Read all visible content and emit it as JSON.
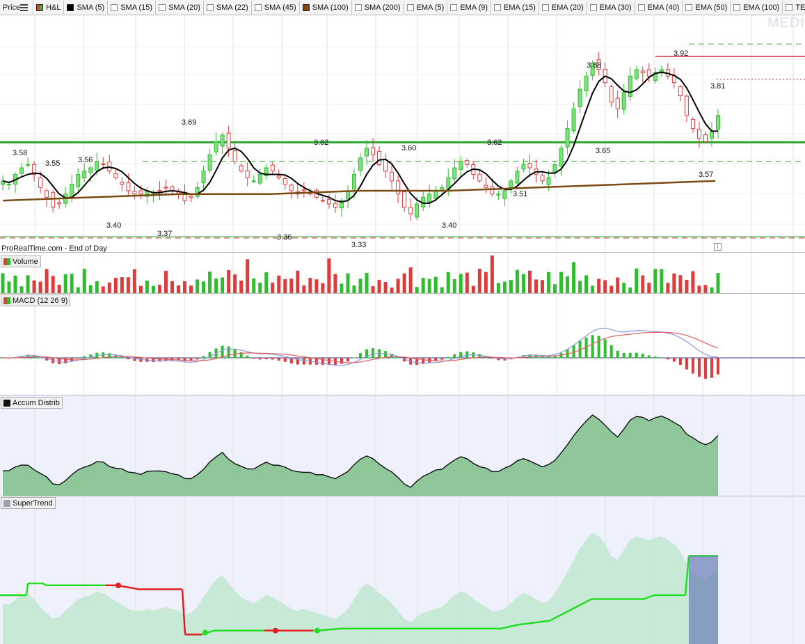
{
  "toolbar": {
    "items": [
      {
        "label": "Price",
        "swatch": "none"
      },
      {
        "label": "H&L",
        "swatch": "hl"
      },
      {
        "label": "SMA (5)",
        "swatch": "#000000"
      },
      {
        "label": "SMA (15)",
        "swatch": "empty"
      },
      {
        "label": "SMA (20)",
        "swatch": "empty"
      },
      {
        "label": "SMA (22)",
        "swatch": "empty"
      },
      {
        "label": "SMA (45)",
        "swatch": "empty"
      },
      {
        "label": "SMA (100)",
        "swatch": "#7b4a12"
      },
      {
        "label": "SMA (200)",
        "swatch": "empty"
      },
      {
        "label": "EMA (5)",
        "swatch": "empty"
      },
      {
        "label": "EMA (9)",
        "swatch": "empty"
      },
      {
        "label": "EMA (15)",
        "swatch": "empty"
      },
      {
        "label": "EMA (20)",
        "swatch": "empty"
      },
      {
        "label": "EMA (30)",
        "swatch": "empty"
      },
      {
        "label": "EMA (40)",
        "swatch": "empty"
      },
      {
        "label": "EMA (50)",
        "swatch": "empty"
      },
      {
        "label": "EMA (100)",
        "swatch": "empty"
      },
      {
        "label": "TEST ATR S",
        "swatch": "empty"
      }
    ]
  },
  "watermark": "MEDI",
  "footer": "ProRealTime.com - End of Day",
  "panels": {
    "volume": {
      "label": "Volume"
    },
    "macd": {
      "label": "MACD (12 26 9)"
    },
    "accum": {
      "label": "Accum Distrib"
    },
    "supertrend": {
      "label": "SuperTrend"
    }
  },
  "price_labels": [
    "3.58",
    "3.55",
    "3.56",
    "3.40",
    "3.37",
    "3.69",
    "3.36",
    "3.62",
    "3.33",
    "3.60",
    "3.40",
    "3.62",
    "3.51",
    "3.88",
    "3.65",
    "3.92",
    "3.81",
    "3.57"
  ],
  "colors": {
    "up": "#2fbd2f",
    "down": "#e03b3b",
    "sma5": "#000000",
    "sma100": "#7b4a12",
    "support": "#2aa52a",
    "resist": "#d03030",
    "macd": "#8899dd",
    "signal": "#e06060",
    "accum": "#8fc79b",
    "st_up": "#22dd22",
    "st_down": "#e02020"
  },
  "chart_data": {
    "type": "candlestick",
    "price_range": [
      3.3,
      3.98
    ],
    "closes": [
      3.5,
      3.49,
      3.52,
      3.54,
      3.55,
      3.52,
      3.48,
      3.45,
      3.42,
      3.43,
      3.46,
      3.49,
      3.52,
      3.53,
      3.54,
      3.56,
      3.55,
      3.53,
      3.51,
      3.49,
      3.47,
      3.46,
      3.46,
      3.47,
      3.46,
      3.47,
      3.48,
      3.47,
      3.46,
      3.44,
      3.45,
      3.48,
      3.53,
      3.58,
      3.62,
      3.64,
      3.6,
      3.56,
      3.53,
      3.51,
      3.5,
      3.52,
      3.54,
      3.53,
      3.51,
      3.49,
      3.47,
      3.46,
      3.47,
      3.46,
      3.45,
      3.44,
      3.43,
      3.42,
      3.44,
      3.47,
      3.52,
      3.57,
      3.6,
      3.58,
      3.55,
      3.53,
      3.5,
      3.46,
      3.42,
      3.4,
      3.43,
      3.45,
      3.46,
      3.47,
      3.48,
      3.51,
      3.54,
      3.56,
      3.55,
      3.52,
      3.5,
      3.48,
      3.46,
      3.46,
      3.47,
      3.5,
      3.53,
      3.55,
      3.54,
      3.52,
      3.5,
      3.51,
      3.55,
      3.6,
      3.66,
      3.72,
      3.78,
      3.82,
      3.86,
      3.84,
      3.8,
      3.74,
      3.72,
      3.77,
      3.82,
      3.84,
      3.83,
      3.82,
      3.83,
      3.84,
      3.82,
      3.8,
      3.76,
      3.7,
      3.66,
      3.63,
      3.62,
      3.65,
      3.7
    ],
    "sma100": [
      3.44,
      3.45,
      3.46,
      3.46,
      3.47,
      3.47,
      3.48,
      3.49,
      3.5
    ],
    "volume_range": [
      0,
      1
    ]
  }
}
